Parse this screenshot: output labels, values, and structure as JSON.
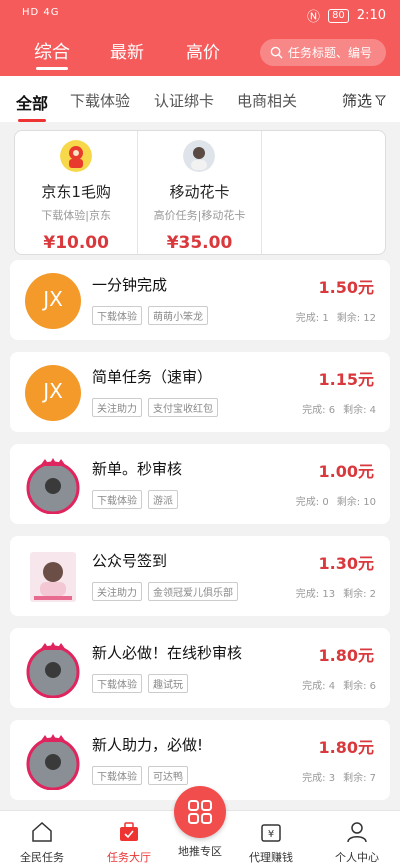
{
  "status": {
    "left": "HD 4G",
    "right_battery": "80",
    "time": "2:10"
  },
  "top_tabs": [
    {
      "label": "综合",
      "active": true
    },
    {
      "label": "最新",
      "active": false
    },
    {
      "label": "高价",
      "active": false
    }
  ],
  "search": {
    "placeholder": "任务标题、编号"
  },
  "category_tabs": [
    {
      "label": "全部",
      "active": true
    },
    {
      "label": "下载体验",
      "active": false
    },
    {
      "label": "认证绑卡",
      "active": false
    },
    {
      "label": "电商相关",
      "active": false
    }
  ],
  "filter_label": "筛选",
  "featured": [
    {
      "title": "京东1毛购",
      "sub": "下载体验|京东",
      "price": "¥10.00",
      "icon": "lucky-god-icon"
    },
    {
      "title": "移动花卡",
      "sub": "高价任务|移动花卡",
      "price": "¥35.00",
      "icon": "photo-avatar-icon"
    }
  ],
  "tasks": [
    {
      "title": "一分钟完成",
      "price": "1.50元",
      "tags": [
        "下载体验",
        "萌萌小笨龙"
      ],
      "done": "完成: 1",
      "left": "剩余: 12",
      "avatar": "orange-logo"
    },
    {
      "title": "简单任务（速审）",
      "price": "1.15元",
      "tags": [
        "关注助力",
        "支付宝收红包"
      ],
      "done": "完成: 6",
      "left": "剩余: 4",
      "avatar": "orange-logo"
    },
    {
      "title": "新单。秒审核",
      "price": "1.00元",
      "tags": [
        "下载体验",
        "游派"
      ],
      "done": "完成: 0",
      "left": "剩余: 10",
      "avatar": "crown-avatar"
    },
    {
      "title": "公众号签到",
      "price": "1.30元",
      "tags": [
        "关注助力",
        "金领冠爱儿俱乐部"
      ],
      "done": "完成: 13",
      "left": "剩余: 2",
      "avatar": "photo-avatar"
    },
    {
      "title": "新人必做！在线秒审核",
      "price": "1.80元",
      "tags": [
        "下载体验",
        "趣试玩"
      ],
      "done": "完成: 4",
      "left": "剩余: 6",
      "avatar": "crown-avatar"
    },
    {
      "title": "新人助力，必做!",
      "price": "1.80元",
      "tags": [
        "下载体验",
        "可达鸭"
      ],
      "done": "完成: 3",
      "left": "剩余: 7",
      "avatar": "crown-avatar"
    }
  ],
  "bottom_nav": [
    {
      "label": "全民任务",
      "icon": "house-icon",
      "active": false
    },
    {
      "label": "任务大厅",
      "icon": "briefcase-icon",
      "active": true
    },
    {
      "label": "地推专区",
      "icon": "grid-icon",
      "active": false
    },
    {
      "label": "代理赚钱",
      "icon": "money-icon",
      "active": false
    },
    {
      "label": "个人中心",
      "icon": "person-icon",
      "active": false
    }
  ],
  "colors": {
    "brand": "#f55b5b",
    "price": "#d9393c"
  }
}
